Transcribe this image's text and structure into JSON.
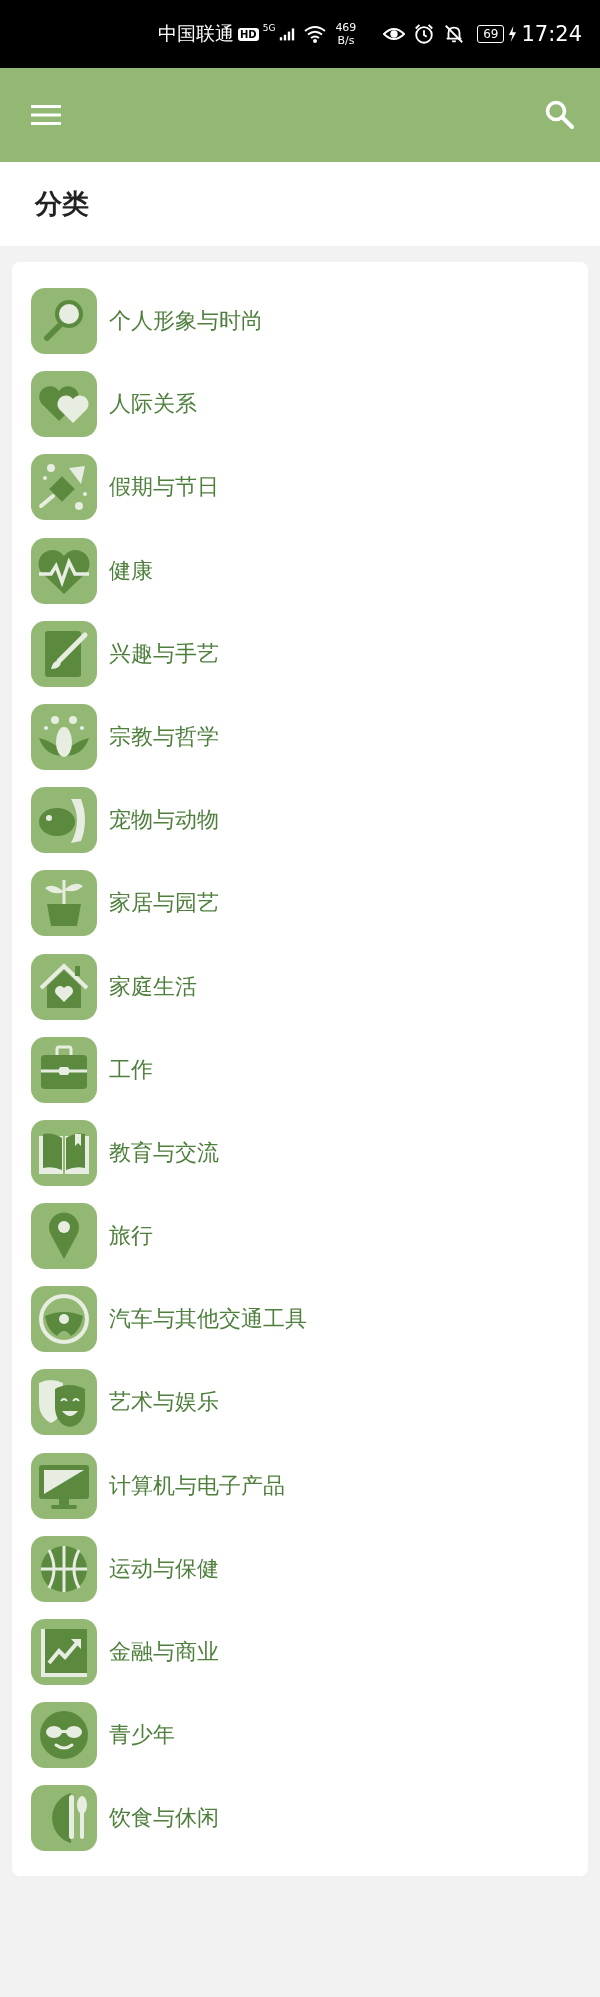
{
  "status_bar": {
    "carrier": "中国联通",
    "network_badge": "HD",
    "network_type": "5G",
    "speed_value": "469",
    "speed_unit": "B/s",
    "battery": "69",
    "time": "17:24"
  },
  "page_title": "分类",
  "categories": [
    {
      "label": "个人形象与时尚"
    },
    {
      "label": "人际关系"
    },
    {
      "label": "假期与节日"
    },
    {
      "label": "健康"
    },
    {
      "label": "兴趣与手艺"
    },
    {
      "label": "宗教与哲学"
    },
    {
      "label": "宠物与动物"
    },
    {
      "label": "家居与园艺"
    },
    {
      "label": "家庭生活"
    },
    {
      "label": "工作"
    },
    {
      "label": "教育与交流"
    },
    {
      "label": "旅行"
    },
    {
      "label": "汽车与其他交通工具"
    },
    {
      "label": "艺术与娱乐"
    },
    {
      "label": "计算机与电子产品"
    },
    {
      "label": "运动与保健"
    },
    {
      "label": "金融与商业"
    },
    {
      "label": "青少年"
    },
    {
      "label": "饮食与休闲"
    }
  ]
}
